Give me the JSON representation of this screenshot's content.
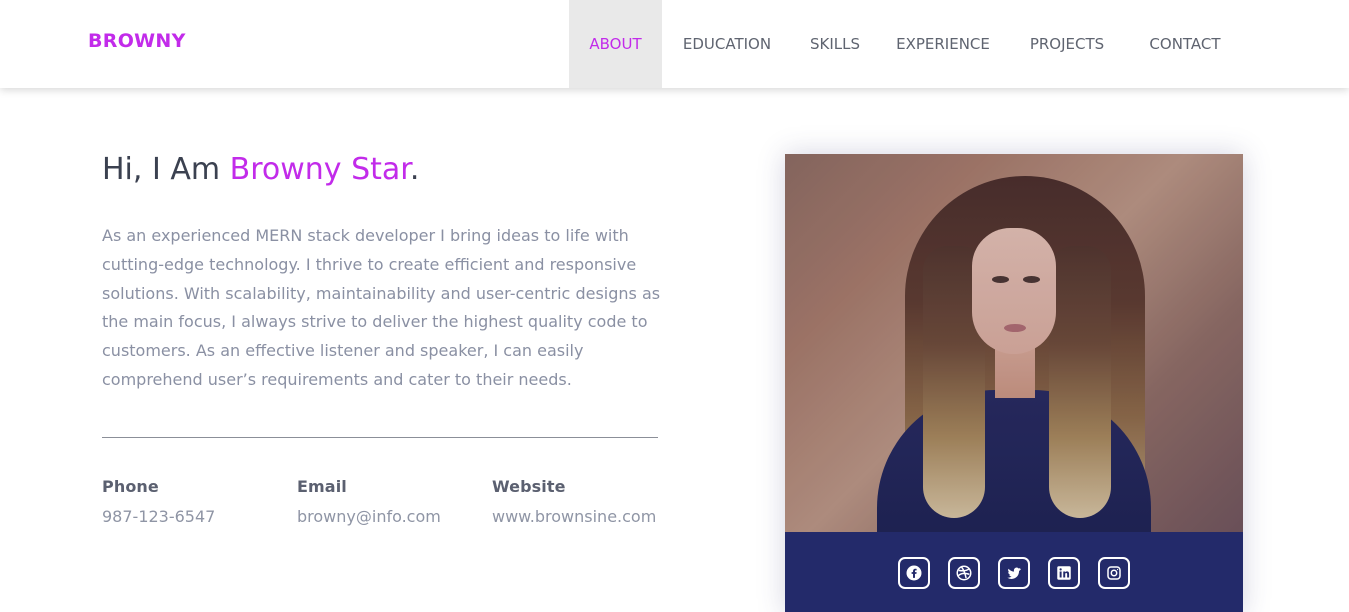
{
  "brand": {
    "name": "BROWNY"
  },
  "nav": {
    "items": [
      {
        "label": "ABOUT",
        "active": true
      },
      {
        "label": "EDUCATION",
        "active": false
      },
      {
        "label": "SKILLS",
        "active": false
      },
      {
        "label": "EXPERIENCE",
        "active": false
      },
      {
        "label": "PROJECTS",
        "active": false
      },
      {
        "label": "CONTACT",
        "active": false
      }
    ]
  },
  "hero": {
    "greeting_prefix": "Hi, I Am ",
    "name": "Browny Star",
    "greeting_suffix": ".",
    "intro": "As an experienced MERN stack developer I bring ideas to life with cutting-edge technology. I thrive to create efficient and responsive solutions. With scalability, maintainability and user-centric designs as the main focus, I always strive to deliver the highest quality code to customers. As an effective listener and speaker, I can easily comprehend user’s requirements and cater to their needs."
  },
  "contact": {
    "phone": {
      "label": "Phone",
      "value": "987-123-6547"
    },
    "email": {
      "label": "Email",
      "value": "browny@info.com"
    },
    "website": {
      "label": "Website",
      "value": "www.brownsine.com"
    }
  },
  "profile": {
    "social_icons": [
      "facebook-icon",
      "dribbble-icon",
      "twitter-icon",
      "linkedin-icon",
      "instagram-icon"
    ]
  },
  "colors": {
    "accent": "#c22bea",
    "active_nav_bg": "#e9e9e9",
    "social_bar": "#232a6a",
    "text_dark": "#3b4150",
    "text_muted": "#8a90a3"
  }
}
